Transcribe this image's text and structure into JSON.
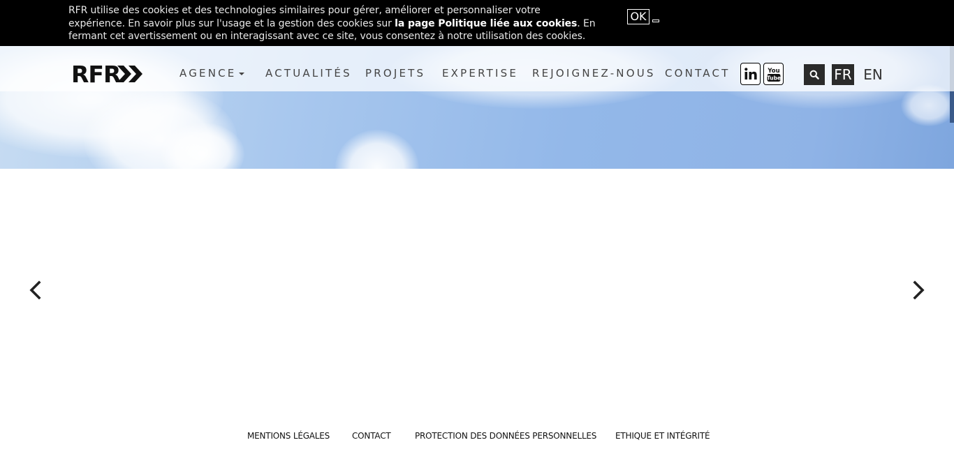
{
  "cookie_banner": {
    "text_before": "RFR utilise des cookies et des technologies similaires pour gérer, améliorer et personnaliser votre expérience. En savoir plus sur l'usage et la gestion des cookies sur ",
    "link_text": "la page Politique liée aux cookies",
    "text_after": ". En fermant cet avertissement ou en interagissant avec ce site, vous consentez à notre utilisation des cookies.",
    "ok_label": "OK"
  },
  "header": {
    "logo_text": "RFR",
    "nav": [
      {
        "label": "AGENCE",
        "has_dropdown": true
      },
      {
        "label": "ACTUALITÉS"
      },
      {
        "label": "PROJETS"
      },
      {
        "label": "EXPERTISE"
      },
      {
        "label": "REJOIGNEZ-NOUS"
      },
      {
        "label": "CONTACT"
      }
    ],
    "social": [
      {
        "icon": "linkedin-icon",
        "text": "in"
      },
      {
        "icon": "youtube-icon",
        "text": "You Tube"
      }
    ],
    "search_icon": "search-icon",
    "languages": [
      {
        "label": "FR",
        "active": true
      },
      {
        "label": "EN",
        "active": false
      }
    ]
  },
  "carousel": {
    "prev_icon": "chevron-left-icon",
    "next_icon": "chevron-right-icon"
  },
  "footer": {
    "links": [
      {
        "label": "MENTIONS LÉGALES"
      },
      {
        "label": "CONTACT"
      },
      {
        "label": "PROTECTION DES DONNÉES PERSONNELLES"
      },
      {
        "label": "ETHIQUE ET INTÉGRITÉ"
      }
    ]
  },
  "colors": {
    "banner_bg": "#000000",
    "accent_dark": "#2b2b2b",
    "nav_text": "#444444"
  }
}
